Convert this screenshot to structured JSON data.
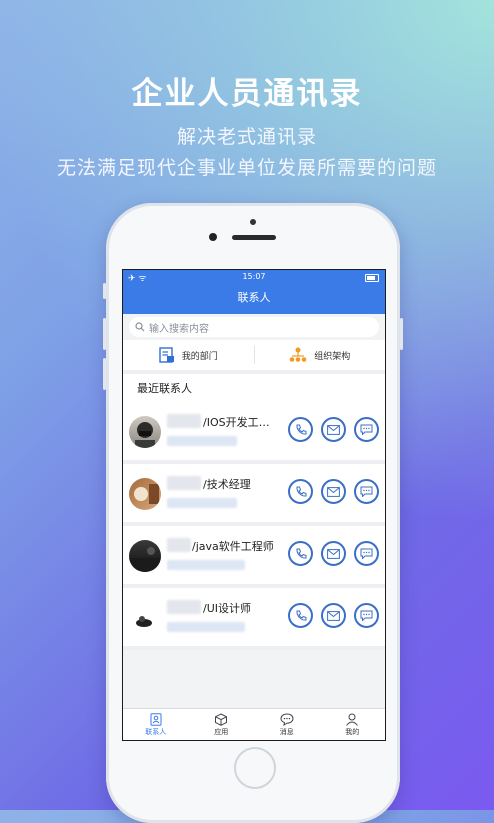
{
  "promo": {
    "headline": "企业人员通讯录",
    "subline1": "解决老式通讯录",
    "subline2": "无法满足现代企事业单位发展所需要的问题"
  },
  "status_bar": {
    "time": "15:07"
  },
  "nav": {
    "title": "联系人"
  },
  "search": {
    "placeholder": "输入搜索内容"
  },
  "quick_links": [
    {
      "label": "我的部门",
      "icon": "department-icon"
    },
    {
      "label": "组织架构",
      "icon": "org-chart-icon"
    }
  ],
  "recent": {
    "title": "最近联系人",
    "contacts": [
      {
        "role": "/IOS开发工…"
      },
      {
        "role": "/技术经理"
      },
      {
        "role": "/java软件工程师"
      },
      {
        "role": "/UI设计师"
      }
    ]
  },
  "tabs": [
    {
      "label": "联系人",
      "icon": "contacts-icon",
      "active": true
    },
    {
      "label": "应用",
      "icon": "cube-icon",
      "active": false
    },
    {
      "label": "消息",
      "icon": "message-icon",
      "active": false
    },
    {
      "label": "我的",
      "icon": "person-icon",
      "active": false
    }
  ],
  "colors": {
    "accent": "#3a7be8",
    "action_ring": "#3b6fc6"
  }
}
